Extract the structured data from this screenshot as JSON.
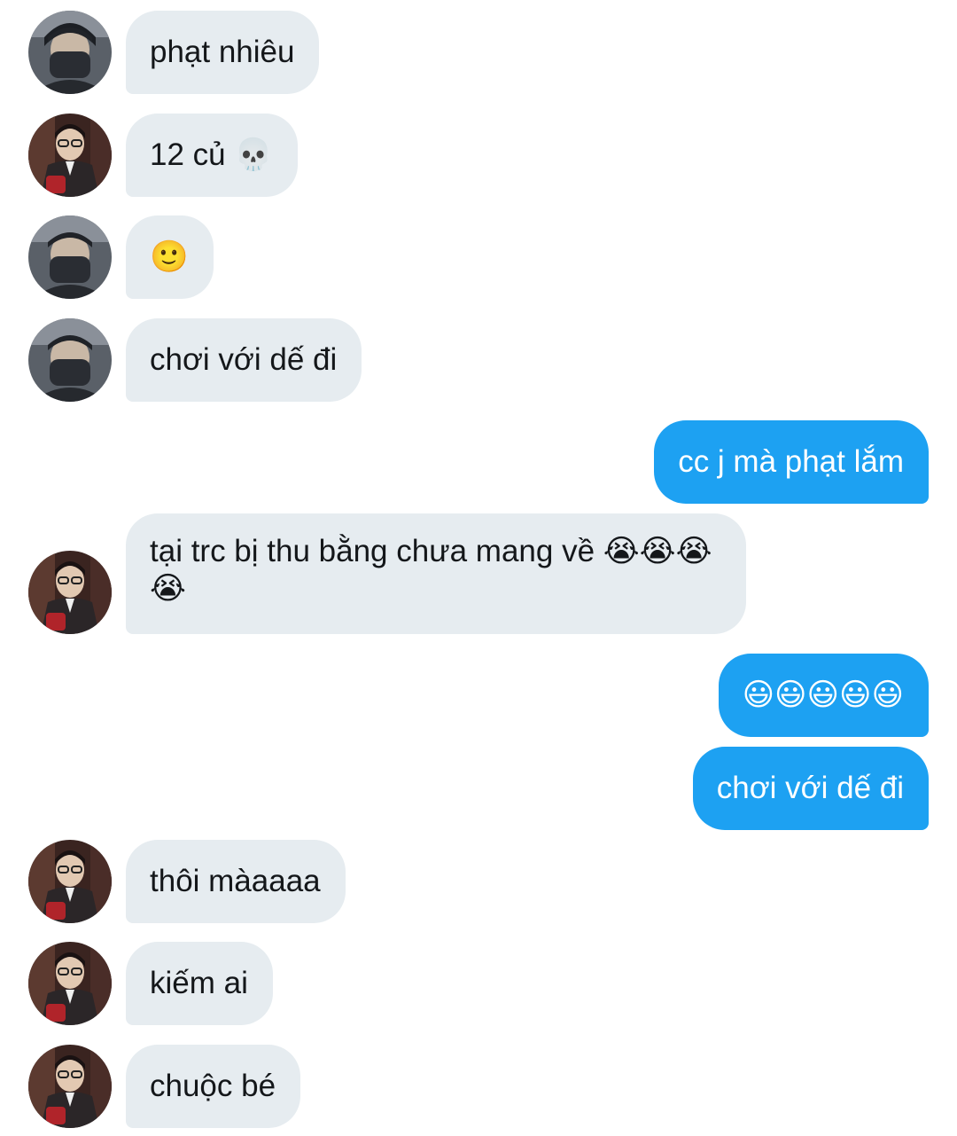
{
  "conversation": {
    "messages": [
      {
        "sender": "friend_a",
        "text": "phạt nhiêu"
      },
      {
        "sender": "friend_b",
        "text": "12 củ 💀"
      },
      {
        "sender": "friend_a",
        "text": "🙂"
      },
      {
        "sender": "friend_a",
        "text": "chơi với dế đi"
      },
      {
        "sender": "me",
        "text": "cc j mà phạt lắm"
      },
      {
        "sender": "friend_b",
        "text": "tại trc bị thu bằng chưa mang về 😭😭😭😭"
      },
      {
        "sender": "me",
        "text": "😃😃😃😃😃"
      },
      {
        "sender": "me",
        "text": "chơi với dế đi"
      },
      {
        "sender": "friend_b",
        "text": "thôi màaaaa"
      },
      {
        "sender": "friend_b",
        "text": "kiếm ai"
      },
      {
        "sender": "friend_b",
        "text": "chuộc bé"
      }
    ]
  },
  "colors": {
    "incoming_bubble": "#e6ecf0",
    "outgoing_bubble": "#1da1f2",
    "incoming_text": "#14171a",
    "outgoing_text": "#ffffff"
  },
  "icons": {
    "avatar_a": "masked-person-avatar",
    "avatar_b": "glasses-person-avatar"
  }
}
